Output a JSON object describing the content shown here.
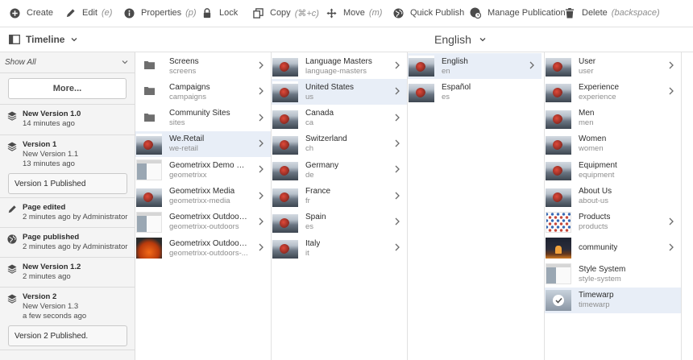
{
  "toolbar": {
    "create": "Create",
    "edit": "Edit",
    "edit_key": "(e)",
    "properties": "Properties",
    "properties_key": "(p)",
    "lock": "Lock",
    "copy": "Copy",
    "copy_key": "(⌘+c)",
    "move": "Move",
    "move_key": "(m)",
    "quick_publish": "Quick Publish",
    "manage_publication": "Manage Publication",
    "delete": "Delete",
    "delete_key": "(backspace)"
  },
  "subheader": {
    "rail_label": "Timeline",
    "title": "English"
  },
  "timeline": {
    "filter": "Show All",
    "more_label": "More...",
    "items": [
      {
        "title": "New Version 1.0",
        "lines": [
          "14 minutes ago"
        ],
        "icon": "layers-icon"
      },
      {
        "title": "Version 1",
        "lines": [
          "New Version 1.1",
          "13 minutes ago"
        ],
        "icon": "layers-icon",
        "note": "Version 1 Published"
      },
      {
        "title": "Page edited",
        "lines": [
          "2 minutes ago by Administrator"
        ],
        "icon": "pencil-icon"
      },
      {
        "title": "Page published",
        "lines": [
          "2 minutes ago by Administrator"
        ],
        "icon": "globe-icon"
      },
      {
        "title": "New Version 1.2",
        "lines": [
          "2 minutes ago"
        ],
        "icon": "layers-icon"
      },
      {
        "title": "Version 2",
        "lines": [
          "New Version 1.3",
          "a few seconds ago"
        ],
        "icon": "layers-icon",
        "note": "Version 2 Published."
      }
    ]
  },
  "col1": [
    {
      "name": "Screens",
      "key": "screens",
      "thumb": "folder"
    },
    {
      "name": "Campaigns",
      "key": "campaigns",
      "thumb": "folder"
    },
    {
      "name": "Community Sites",
      "key": "sites",
      "thumb": "folder"
    },
    {
      "name": "We.Retail",
      "key": "we-retail",
      "thumb": "img"
    },
    {
      "name": "Geometrixx Demo Site",
      "key": "geometrixx",
      "thumb": "light"
    },
    {
      "name": "Geometrixx Media",
      "key": "geometrixx-media",
      "thumb": "img"
    },
    {
      "name": "Geometrixx Outdoors ...",
      "key": "geometrixx-outdoors",
      "thumb": "light"
    },
    {
      "name": "Geometrixx Outdoors ...",
      "key": "geometrixx-outdoors-...",
      "thumb": "orange"
    }
  ],
  "col2": [
    {
      "name": "Language Masters",
      "key": "language-masters"
    },
    {
      "name": "United States",
      "key": "us"
    },
    {
      "name": "Canada",
      "key": "ca"
    },
    {
      "name": "Switzerland",
      "key": "ch"
    },
    {
      "name": "Germany",
      "key": "de"
    },
    {
      "name": "France",
      "key": "fr"
    },
    {
      "name": "Spain",
      "key": "es"
    },
    {
      "name": "Italy",
      "key": "it"
    }
  ],
  "col3": [
    {
      "name": "English",
      "key": "en"
    },
    {
      "name": "Español",
      "key": "es"
    }
  ],
  "col4": [
    {
      "name": "User",
      "key": "user",
      "thumb": "img"
    },
    {
      "name": "Experience",
      "key": "experience",
      "thumb": "img"
    },
    {
      "name": "Men",
      "key": "men",
      "thumb": "img"
    },
    {
      "name": "Women",
      "key": "women",
      "thumb": "img"
    },
    {
      "name": "Equipment",
      "key": "equipment",
      "thumb": "img"
    },
    {
      "name": "About Us",
      "key": "about-us",
      "thumb": "img"
    },
    {
      "name": "Products",
      "key": "products",
      "thumb": "grid"
    },
    {
      "name": "community",
      "key": "",
      "thumb": "dark"
    },
    {
      "name": "Style System",
      "key": "style-system",
      "thumb": "light"
    },
    {
      "name": "Timewarp",
      "key": "timewarp",
      "thumb": "selcheck"
    }
  ]
}
